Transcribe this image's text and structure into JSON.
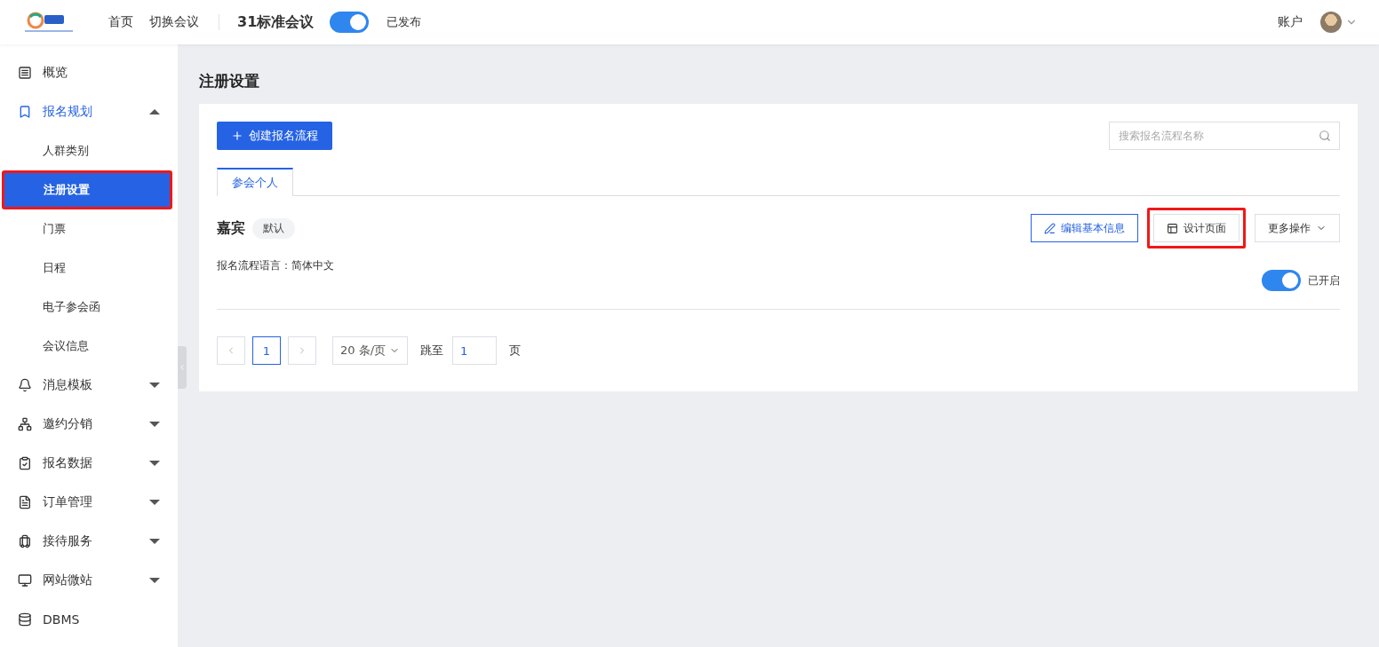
{
  "header": {
    "nav": [
      "首页",
      "切换会议"
    ],
    "meeting_title": "31标准会议",
    "publish_switch": {
      "on": true,
      "label": "已发布"
    },
    "account": "账户"
  },
  "sidebar": {
    "items": [
      {
        "label": "概览",
        "kind": "plain",
        "selected": false
      },
      {
        "label": "报名规划",
        "kind": "group",
        "selected": true,
        "expanded": true,
        "children": [
          {
            "label": "人群类别",
            "selected": false,
            "highlighted": false
          },
          {
            "label": "注册设置",
            "selected": true,
            "highlighted": true
          },
          {
            "label": "门票",
            "selected": false,
            "highlighted": false
          },
          {
            "label": "日程",
            "selected": false,
            "highlighted": false
          },
          {
            "label": "电子参会函",
            "selected": false,
            "highlighted": false
          },
          {
            "label": "会议信息",
            "selected": false,
            "highlighted": false
          }
        ]
      },
      {
        "label": "消息模板",
        "kind": "group",
        "selected": false,
        "expanded": false
      },
      {
        "label": "邀约分销",
        "kind": "group",
        "selected": false,
        "expanded": false
      },
      {
        "label": "报名数据",
        "kind": "group",
        "selected": false,
        "expanded": false
      },
      {
        "label": "订单管理",
        "kind": "group",
        "selected": false,
        "expanded": false
      },
      {
        "label": "接待服务",
        "kind": "group",
        "selected": false,
        "expanded": false
      },
      {
        "label": "网站微站",
        "kind": "group",
        "selected": false,
        "expanded": false
      },
      {
        "label": "DBMS",
        "kind": "plain",
        "selected": false
      }
    ]
  },
  "page_title": "注册设置",
  "create_button": "创建报名流程",
  "search": {
    "placeholder": "搜索报名流程名称"
  },
  "tabs": [
    {
      "label": "参会个人",
      "selected": true
    }
  ],
  "flow": {
    "name": "嘉宾",
    "tag": "默认",
    "language": "报名流程语言：简体中文",
    "actions": [
      {
        "label": "编辑基本信息",
        "kind": "edit",
        "highlighted": false
      },
      {
        "label": "设计页面",
        "kind": "design",
        "highlighted": true
      },
      {
        "label": "更多操作",
        "kind": "more",
        "highlighted": false
      }
    ],
    "enabled_switch": {
      "on": true,
      "label": "已开启"
    }
  },
  "pagination": {
    "pages": [
      {
        "label": "1",
        "selected": true
      }
    ],
    "page_size": "20 条/页",
    "jump_label": "跳至",
    "jump_value": "1",
    "page_unit": "页"
  }
}
